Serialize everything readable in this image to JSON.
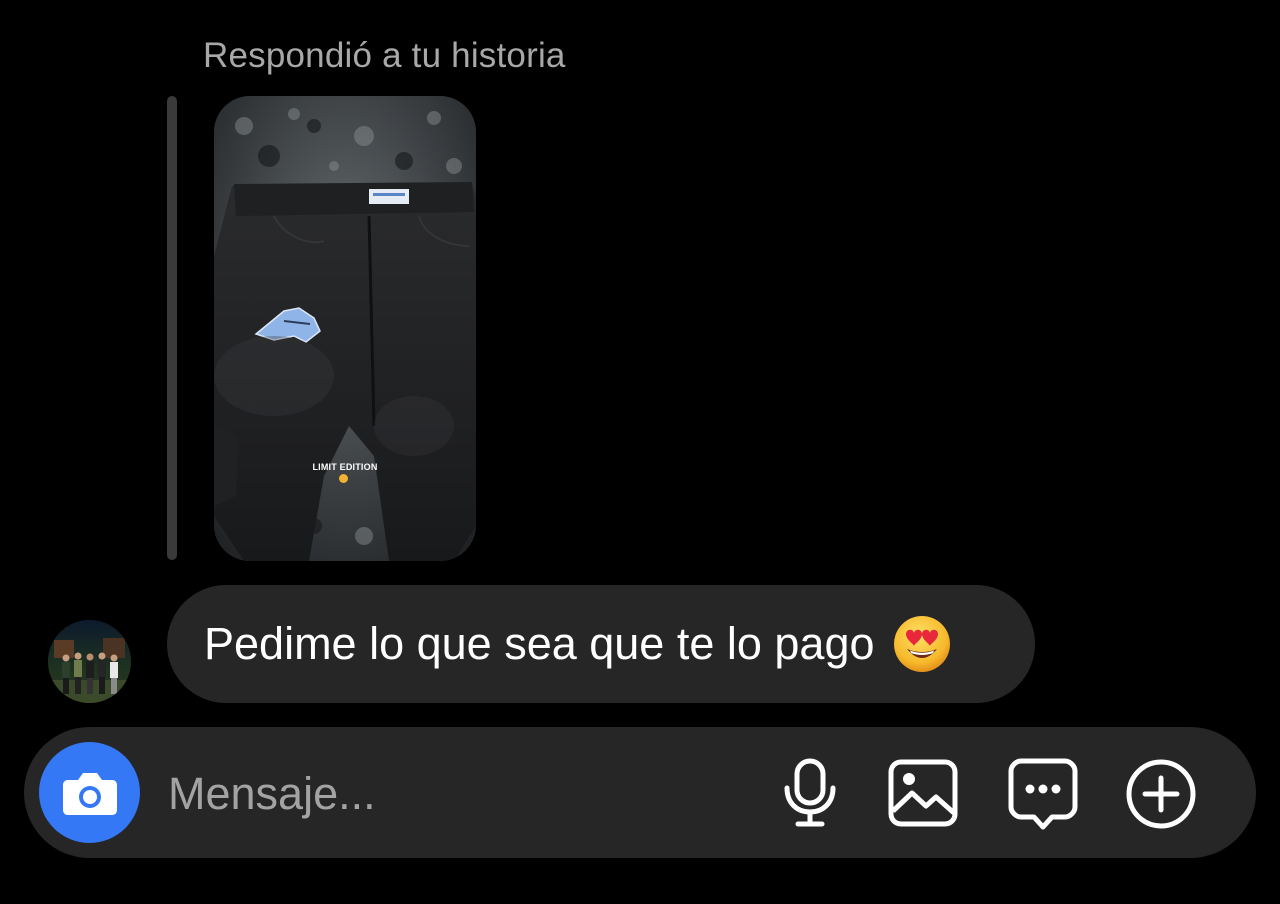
{
  "story_reply": {
    "caption": "Respondió a tu historia",
    "story_overlay_text": "LIMIT EDITION"
  },
  "message": {
    "text": "Pedime lo que sea que te lo pago",
    "emoji": "smiling-face-with-heart-eyes"
  },
  "composer": {
    "placeholder": "Mensaje...",
    "icons": [
      "camera-icon",
      "microphone-icon",
      "gallery-icon",
      "sticker-icon",
      "plus-icon"
    ]
  },
  "colors": {
    "background": "#000000",
    "bubble": "#262626",
    "caption": "#a8a8a8",
    "camera_button": "#3478f6",
    "placeholder": "#a3a3a3"
  }
}
